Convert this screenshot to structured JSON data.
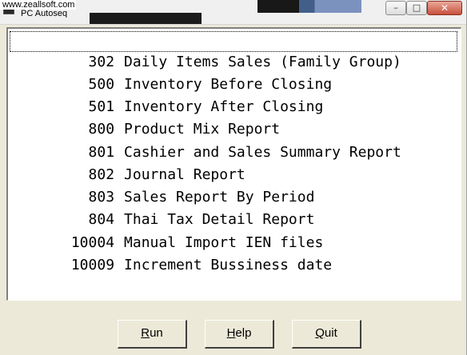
{
  "window": {
    "watermark": "www.zeallsoft.com",
    "title": "PC Autoseq",
    "controls": {
      "minimize_glyph": "–",
      "maximize_glyph": "□",
      "close_glyph": "✕"
    }
  },
  "report_list": {
    "items": [
      {
        "code": "302",
        "label": "Daily Items Sales (Family Group)",
        "selected": true
      },
      {
        "code": "500",
        "label": "Inventory Before Closing",
        "selected": false
      },
      {
        "code": "501",
        "label": "Inventory After Closing",
        "selected": false
      },
      {
        "code": "800",
        "label": "Product Mix Report",
        "selected": false
      },
      {
        "code": "801",
        "label": "Cashier and Sales Summary Report",
        "selected": false
      },
      {
        "code": "802",
        "label": "Journal Report",
        "selected": false
      },
      {
        "code": "803",
        "label": "Sales Report By Period",
        "selected": false
      },
      {
        "code": "804",
        "label": "Thai Tax Detail Report",
        "selected": false
      },
      {
        "code": "10004",
        "label": "Manual Import IEN files",
        "selected": false
      },
      {
        "code": "10009",
        "label": "Increment Bussiness date",
        "selected": false
      }
    ]
  },
  "buttons": {
    "run": {
      "mnemonic": "R",
      "rest": "un"
    },
    "help": {
      "mnemonic": "H",
      "rest": "elp"
    },
    "quit": {
      "mnemonic": "Q",
      "rest": "uit"
    }
  }
}
